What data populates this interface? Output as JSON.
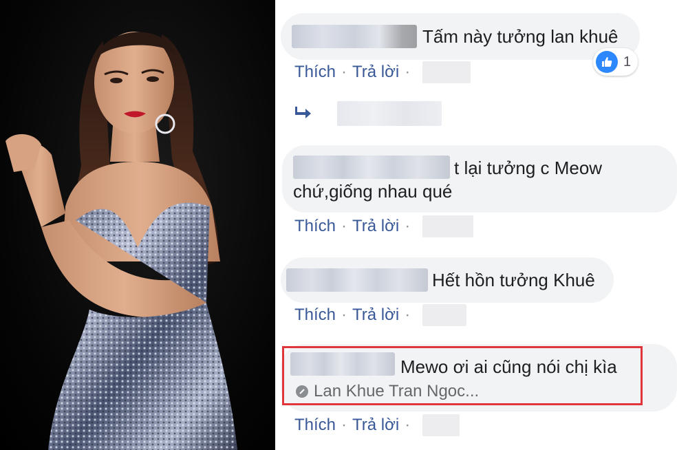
{
  "comments": [
    {
      "text": "Tấm này tưởng lan khuê",
      "like_label": "Thích",
      "reply_label": "Trả lời",
      "reaction_count": "1"
    },
    {
      "text_line1": "t lại tưởng c Meow",
      "text_line2": "chứ,giống nhau qué",
      "like_label": "Thích",
      "reply_label": "Trả lời"
    },
    {
      "text": "Hết hồn tưởng Khuê",
      "like_label": "Thích",
      "reply_label": "Trả lời"
    },
    {
      "text": "Mewo ơi ai cũng nói chị kìa",
      "tag": "Lan Khue Tran Ngoc...",
      "like_label": "Thích",
      "reply_label": "Trả lời"
    }
  ],
  "separator": "·",
  "icons": {
    "reaction": "like-thumb-icon",
    "reply": "reply-arrow-icon",
    "tag": "tag-icon"
  },
  "colors": {
    "bubble": "#f2f3f5",
    "link": "#385898",
    "like": "#2d88ff",
    "highlight": "#e0353b"
  }
}
